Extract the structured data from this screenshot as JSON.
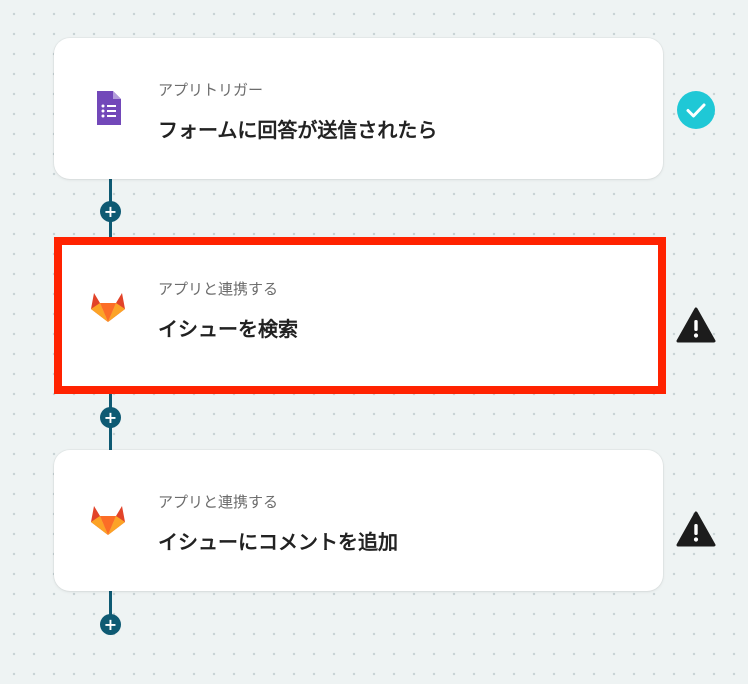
{
  "flow": {
    "steps": [
      {
        "subtitle": "アプリトリガー",
        "title": "フォームに回答が送信されたら",
        "icon": "google-forms-icon",
        "status": "complete"
      },
      {
        "subtitle": "アプリと連携する",
        "title": "イシューを検索",
        "icon": "gitlab-icon",
        "status": "warning"
      },
      {
        "subtitle": "アプリと連携する",
        "title": "イシューにコメントを追加",
        "icon": "gitlab-icon",
        "status": "warning"
      }
    ],
    "add_label": "+"
  },
  "colors": {
    "connector": "#0e5a73",
    "selection": "#ff2200",
    "check": "#1fc8d6",
    "warning": "#1c1c1c",
    "forms_purple": "#7248b9",
    "gitlab_orange": "#e24329"
  }
}
